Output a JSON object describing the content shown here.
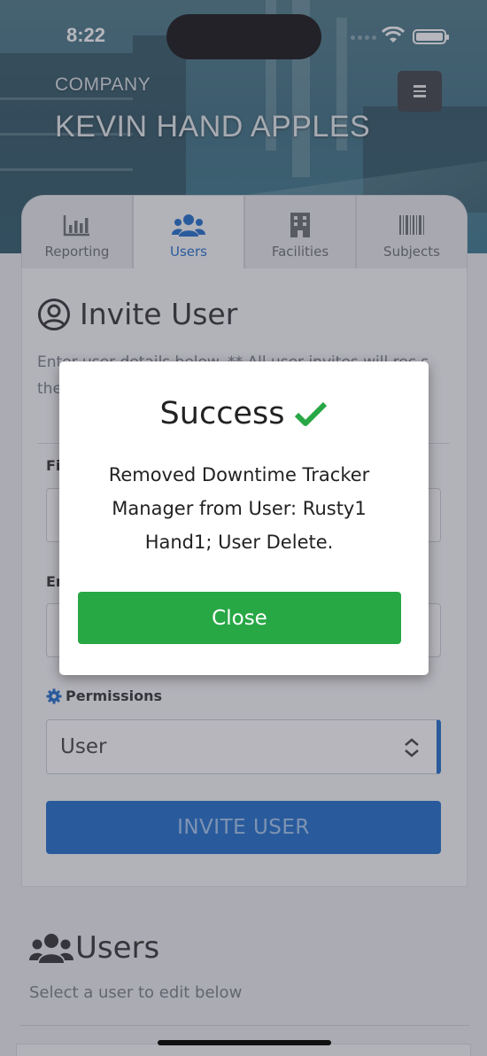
{
  "status_bar": {
    "time": "8:22"
  },
  "header": {
    "company_label": "COMPANY",
    "company_name": "KEVIN HAND APPLES"
  },
  "tabs": [
    {
      "label": "Reporting",
      "icon": "bar-chart-icon"
    },
    {
      "label": "Users",
      "icon": "users-icon",
      "active": true
    },
    {
      "label": "Facilities",
      "icon": "building-icon"
    },
    {
      "label": "Subjects",
      "icon": "barcode-icon"
    }
  ],
  "invite": {
    "title": "Invite User",
    "description": "Enter user details below. ** All user invites will rec                                                          s the",
    "first_label": "Fi",
    "email_label": "Er",
    "permissions_label": "Permissions",
    "permission_value": "User",
    "button": "INVITE USER"
  },
  "users_section": {
    "title": "Users",
    "description": "Select a user to edit below"
  },
  "modal": {
    "title": "Success",
    "message": "Removed Downtime Tracker Manager from User: Rusty1 Hand1; User Delete.",
    "close": "Close"
  },
  "colors": {
    "primary": "#0d63c9",
    "success": "#28a745",
    "header": "#2f6578"
  }
}
